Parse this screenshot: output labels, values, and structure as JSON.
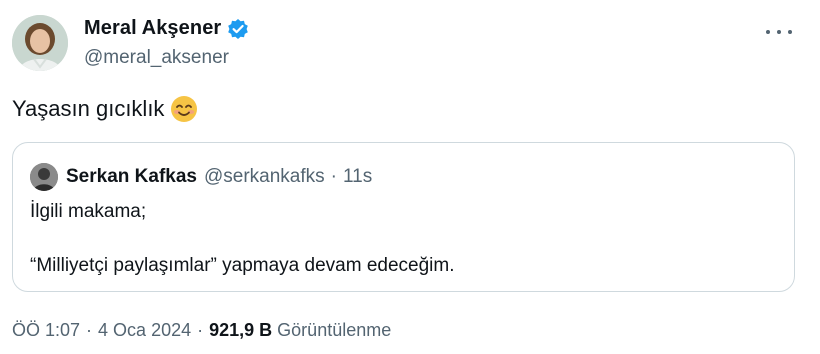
{
  "author": {
    "display_name": "Meral Akşener",
    "handle": "@meral_aksener"
  },
  "tweet": {
    "text": "Yaşasın gıcıklık",
    "emoji": "smiling-face-with-smiling-eyes"
  },
  "quoted_tweet": {
    "display_name": "Serkan Kafkas",
    "handle": "@serkankafks",
    "separator": "·",
    "time": "11s",
    "line1": "İlgili makama;",
    "line2": "“Milliyetçi paylaşımlar” yapmaya devam edeceğim."
  },
  "meta": {
    "time": "ÖÖ 1:07",
    "separator": "·",
    "date": "4 Oca 2024",
    "views_count": "921,9 B",
    "views_label": "Görüntülenme"
  },
  "colors": {
    "verified": "#1d9bf0",
    "secondary_text": "#536471",
    "border": "#cfd9de"
  }
}
